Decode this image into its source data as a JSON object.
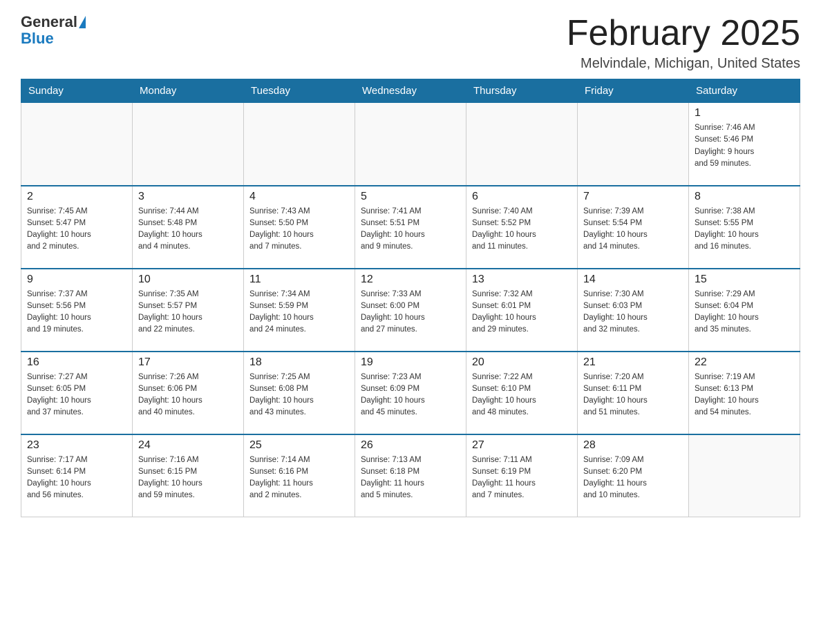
{
  "logo": {
    "general": "General",
    "blue": "Blue"
  },
  "title": {
    "month_year": "February 2025",
    "location": "Melvindale, Michigan, United States"
  },
  "headers": [
    "Sunday",
    "Monday",
    "Tuesday",
    "Wednesday",
    "Thursday",
    "Friday",
    "Saturday"
  ],
  "weeks": [
    [
      {
        "day": "",
        "info": ""
      },
      {
        "day": "",
        "info": ""
      },
      {
        "day": "",
        "info": ""
      },
      {
        "day": "",
        "info": ""
      },
      {
        "day": "",
        "info": ""
      },
      {
        "day": "",
        "info": ""
      },
      {
        "day": "1",
        "info": "Sunrise: 7:46 AM\nSunset: 5:46 PM\nDaylight: 9 hours\nand 59 minutes."
      }
    ],
    [
      {
        "day": "2",
        "info": "Sunrise: 7:45 AM\nSunset: 5:47 PM\nDaylight: 10 hours\nand 2 minutes."
      },
      {
        "day": "3",
        "info": "Sunrise: 7:44 AM\nSunset: 5:48 PM\nDaylight: 10 hours\nand 4 minutes."
      },
      {
        "day": "4",
        "info": "Sunrise: 7:43 AM\nSunset: 5:50 PM\nDaylight: 10 hours\nand 7 minutes."
      },
      {
        "day": "5",
        "info": "Sunrise: 7:41 AM\nSunset: 5:51 PM\nDaylight: 10 hours\nand 9 minutes."
      },
      {
        "day": "6",
        "info": "Sunrise: 7:40 AM\nSunset: 5:52 PM\nDaylight: 10 hours\nand 11 minutes."
      },
      {
        "day": "7",
        "info": "Sunrise: 7:39 AM\nSunset: 5:54 PM\nDaylight: 10 hours\nand 14 minutes."
      },
      {
        "day": "8",
        "info": "Sunrise: 7:38 AM\nSunset: 5:55 PM\nDaylight: 10 hours\nand 16 minutes."
      }
    ],
    [
      {
        "day": "9",
        "info": "Sunrise: 7:37 AM\nSunset: 5:56 PM\nDaylight: 10 hours\nand 19 minutes."
      },
      {
        "day": "10",
        "info": "Sunrise: 7:35 AM\nSunset: 5:57 PM\nDaylight: 10 hours\nand 22 minutes."
      },
      {
        "day": "11",
        "info": "Sunrise: 7:34 AM\nSunset: 5:59 PM\nDaylight: 10 hours\nand 24 minutes."
      },
      {
        "day": "12",
        "info": "Sunrise: 7:33 AM\nSunset: 6:00 PM\nDaylight: 10 hours\nand 27 minutes."
      },
      {
        "day": "13",
        "info": "Sunrise: 7:32 AM\nSunset: 6:01 PM\nDaylight: 10 hours\nand 29 minutes."
      },
      {
        "day": "14",
        "info": "Sunrise: 7:30 AM\nSunset: 6:03 PM\nDaylight: 10 hours\nand 32 minutes."
      },
      {
        "day": "15",
        "info": "Sunrise: 7:29 AM\nSunset: 6:04 PM\nDaylight: 10 hours\nand 35 minutes."
      }
    ],
    [
      {
        "day": "16",
        "info": "Sunrise: 7:27 AM\nSunset: 6:05 PM\nDaylight: 10 hours\nand 37 minutes."
      },
      {
        "day": "17",
        "info": "Sunrise: 7:26 AM\nSunset: 6:06 PM\nDaylight: 10 hours\nand 40 minutes."
      },
      {
        "day": "18",
        "info": "Sunrise: 7:25 AM\nSunset: 6:08 PM\nDaylight: 10 hours\nand 43 minutes."
      },
      {
        "day": "19",
        "info": "Sunrise: 7:23 AM\nSunset: 6:09 PM\nDaylight: 10 hours\nand 45 minutes."
      },
      {
        "day": "20",
        "info": "Sunrise: 7:22 AM\nSunset: 6:10 PM\nDaylight: 10 hours\nand 48 minutes."
      },
      {
        "day": "21",
        "info": "Sunrise: 7:20 AM\nSunset: 6:11 PM\nDaylight: 10 hours\nand 51 minutes."
      },
      {
        "day": "22",
        "info": "Sunrise: 7:19 AM\nSunset: 6:13 PM\nDaylight: 10 hours\nand 54 minutes."
      }
    ],
    [
      {
        "day": "23",
        "info": "Sunrise: 7:17 AM\nSunset: 6:14 PM\nDaylight: 10 hours\nand 56 minutes."
      },
      {
        "day": "24",
        "info": "Sunrise: 7:16 AM\nSunset: 6:15 PM\nDaylight: 10 hours\nand 59 minutes."
      },
      {
        "day": "25",
        "info": "Sunrise: 7:14 AM\nSunset: 6:16 PM\nDaylight: 11 hours\nand 2 minutes."
      },
      {
        "day": "26",
        "info": "Sunrise: 7:13 AM\nSunset: 6:18 PM\nDaylight: 11 hours\nand 5 minutes."
      },
      {
        "day": "27",
        "info": "Sunrise: 7:11 AM\nSunset: 6:19 PM\nDaylight: 11 hours\nand 7 minutes."
      },
      {
        "day": "28",
        "info": "Sunrise: 7:09 AM\nSunset: 6:20 PM\nDaylight: 11 hours\nand 10 minutes."
      },
      {
        "day": "",
        "info": ""
      }
    ]
  ]
}
